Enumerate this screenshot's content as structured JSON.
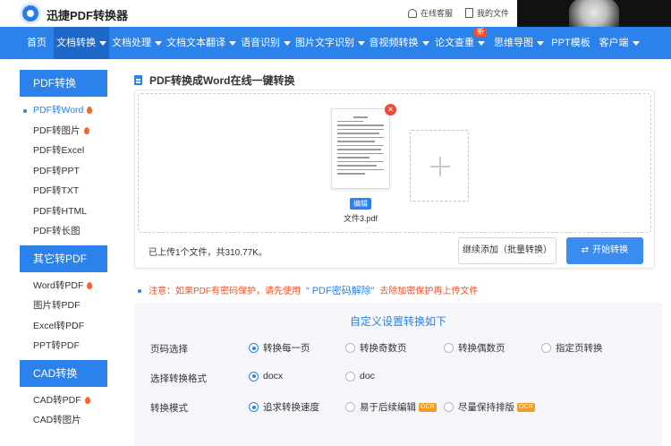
{
  "header": {
    "brand": "迅捷PDF转换器",
    "online_service": "在线客服",
    "my_files": "我的文件"
  },
  "nav": {
    "items": [
      {
        "label": "首页",
        "caret": false
      },
      {
        "label": "文档转换",
        "caret": true,
        "active": true
      },
      {
        "label": "文档处理",
        "caret": true
      },
      {
        "label": "文档文本翻译",
        "caret": true
      },
      {
        "label": "语音识别",
        "caret": true
      },
      {
        "label": "图片文字识别",
        "caret": true
      },
      {
        "label": "音视频转换",
        "caret": true
      },
      {
        "label": "论文查重",
        "caret": true,
        "badge": "新"
      },
      {
        "label": "思维导图",
        "caret": true
      },
      {
        "label": "PPT模板",
        "caret": false
      },
      {
        "label": "客户端",
        "caret": true
      }
    ]
  },
  "sidebar": {
    "groups": [
      {
        "title": "PDF转换",
        "items": [
          {
            "label": "PDF转Word",
            "active": true,
            "hot": true
          },
          {
            "label": "PDF转图片",
            "hot": true
          },
          {
            "label": "PDF转Excel"
          },
          {
            "label": "PDF转PPT"
          },
          {
            "label": "PDF转TXT"
          },
          {
            "label": "PDF转HTML"
          },
          {
            "label": "PDF转长图"
          }
        ]
      },
      {
        "title": "其它转PDF",
        "items": [
          {
            "label": "Word转PDF",
            "hot": true
          },
          {
            "label": "图片转PDF"
          },
          {
            "label": "Excel转PDF"
          },
          {
            "label": "PPT转PDF"
          }
        ]
      },
      {
        "title": "CAD转换",
        "items": [
          {
            "label": "CAD转PDF",
            "hot": true
          },
          {
            "label": "CAD转图片"
          }
        ]
      }
    ]
  },
  "main": {
    "title": "PDF转换成Word在线一键转换",
    "file": {
      "name": "文件3.pdf",
      "edit_label": "编辑",
      "remove_label": "×"
    },
    "summary": "已上传1个文件，共310.77K。",
    "continue_label": "继续添加（批量转换）",
    "start_label": "开始转换",
    "notice": {
      "prefix": "注意：如果PDF有密码保护，请先使用",
      "link": "“ PDF密码解除”",
      "suffix": "去除加密保护再上传文件"
    }
  },
  "settings": {
    "title": "自定义设置转换如下",
    "rows": [
      {
        "label": "页码选择",
        "options": [
          {
            "label": "转换每一页",
            "selected": true
          },
          {
            "label": "转换奇数页"
          },
          {
            "label": "转换偶数页"
          },
          {
            "label": "指定页转换"
          }
        ]
      },
      {
        "label": "选择转换格式",
        "options": [
          {
            "label": "docx",
            "selected": true
          },
          {
            "label": "doc"
          }
        ]
      },
      {
        "label": "转换模式",
        "options": [
          {
            "label": "追求转换速度",
            "selected": true
          },
          {
            "label": "易于后续编辑",
            "ocr": "OCR"
          },
          {
            "label": "尽量保持排版",
            "ocr": "OCR"
          }
        ]
      }
    ]
  },
  "colors": {
    "primary": "#2b82ea",
    "danger": "#f04a3b",
    "warning": "#f39c1f"
  }
}
